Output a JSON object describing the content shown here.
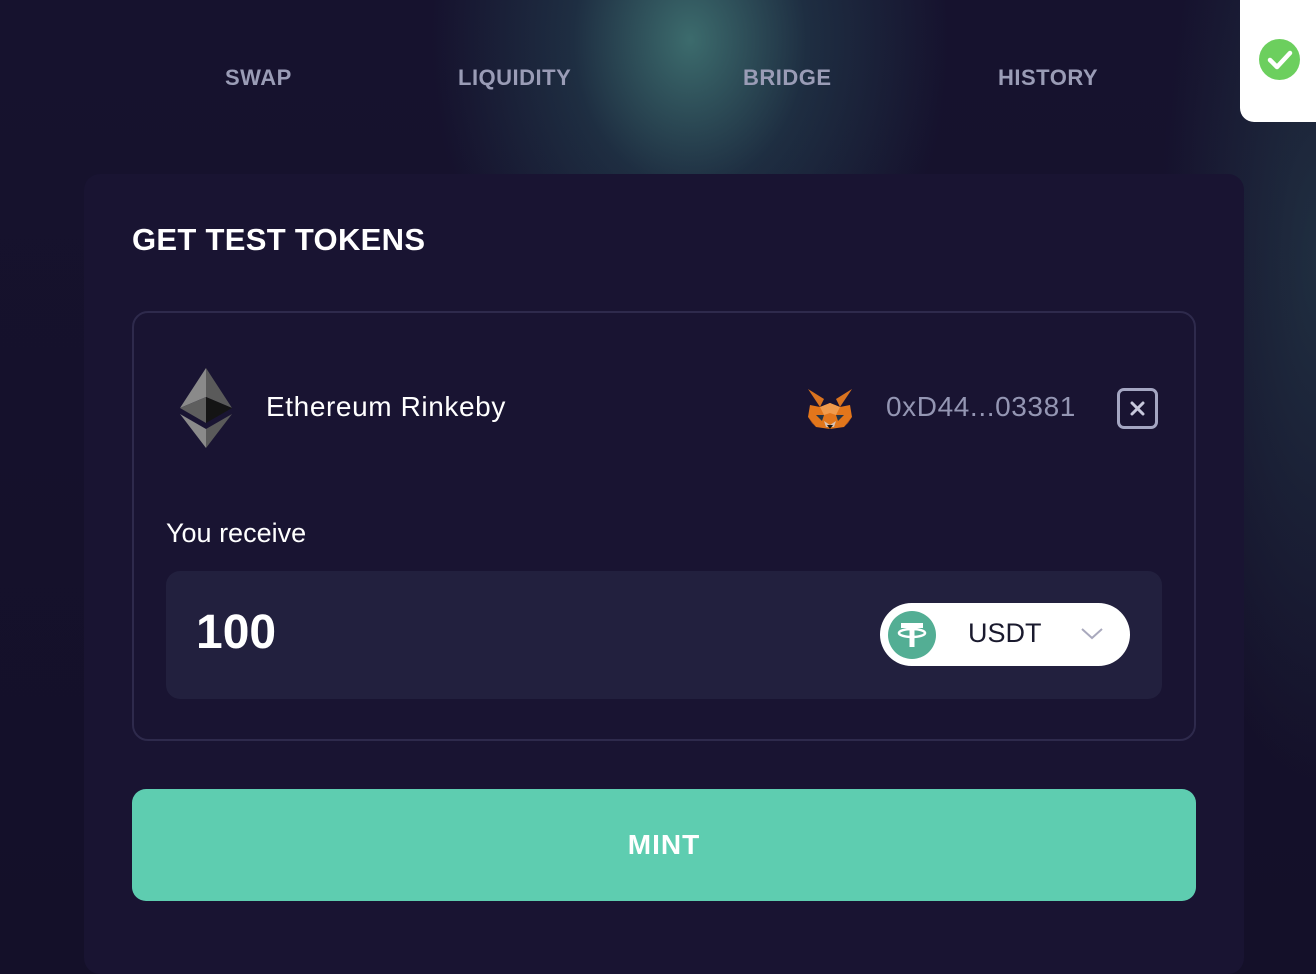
{
  "nav": {
    "tabs": [
      {
        "label": "SWAP"
      },
      {
        "label": "LIQUIDITY"
      },
      {
        "label": "BRIDGE"
      },
      {
        "label": "HISTORY"
      }
    ]
  },
  "toast": {
    "icon": "check-circle-icon",
    "color": "#6ccf5e"
  },
  "card": {
    "title": "GET TEST TOKENS",
    "network": {
      "icon": "ethereum-icon",
      "label": "Ethereum Rinkeby"
    },
    "wallet": {
      "icon": "metamask-fox-icon",
      "address": "0xD44...03381",
      "disconnect_icon": "close-icon"
    },
    "receive_label": "You receive",
    "amount": "100",
    "token": {
      "icon": "usdt-tether-icon",
      "symbol": "USDT",
      "dropdown_icon": "chevron-down-icon"
    },
    "mint_label": "MINT"
  },
  "colors": {
    "background": "#141029",
    "card": "#191432",
    "input": "#22203e",
    "accent": "#5ecdb0",
    "muted_text": "#9496b3"
  }
}
